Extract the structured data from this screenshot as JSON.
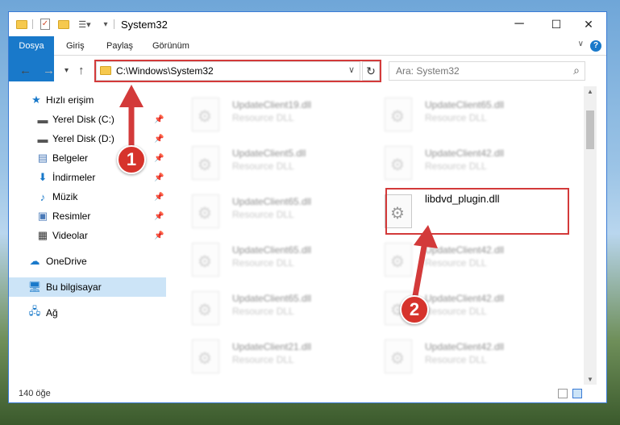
{
  "window": {
    "title": "System32",
    "controls": {
      "minimize": "─",
      "maximize": "☐",
      "close": "✕"
    }
  },
  "ribbon": {
    "tabs": [
      "Dosya",
      "Giriş",
      "Paylaş",
      "Görünüm"
    ],
    "help": "?"
  },
  "nav": {
    "address": "C:\\Windows\\System32",
    "search_placeholder": "Ara: System32"
  },
  "sidebar": {
    "quick_access": "Hızlı erişim",
    "items": [
      {
        "label": "Yerel Disk (C:)",
        "icon": "drive-icon"
      },
      {
        "label": "Yerel Disk (D:)",
        "icon": "drive-icon"
      },
      {
        "label": "Belgeler",
        "icon": "documents-icon"
      },
      {
        "label": "İndirmeler",
        "icon": "downloads-icon"
      },
      {
        "label": "Müzik",
        "icon": "music-icon"
      },
      {
        "label": "Resimler",
        "icon": "pictures-icon"
      },
      {
        "label": "Videolar",
        "icon": "videos-icon"
      }
    ],
    "onedrive": "OneDrive",
    "this_pc": "Bu bilgisayar",
    "network": "Ağ"
  },
  "files": {
    "left": [
      {
        "name": "UpdateClient19.dll",
        "type": "Resource DLL"
      },
      {
        "name": "UpdateClient5.dll",
        "type": "Resource DLL"
      },
      {
        "name": "UpdateClient65.dll",
        "type": "Resource DLL"
      },
      {
        "name": "UpdateClient65.dll",
        "type": "Resource DLL"
      },
      {
        "name": "UpdateClient65.dll",
        "type": "Resource DLL"
      },
      {
        "name": "UpdateClient21.dll",
        "type": "Resource DLL"
      }
    ],
    "right": [
      {
        "name": "UpdateClient65.dll",
        "type": "Resource DLL"
      },
      {
        "name": "UpdateClient42.dll",
        "type": "Resource DLL"
      },
      {
        "name": "libdvd_plugin.dll",
        "type": ""
      },
      {
        "name": "UpdateClient42.dll",
        "type": "Resource DLL"
      },
      {
        "name": "UpdateClient42.dll",
        "type": "Resource DLL"
      },
      {
        "name": "UpdateClient42.dll",
        "type": "Resource DLL"
      }
    ]
  },
  "status": {
    "count": "140 öğe"
  },
  "annotations": {
    "step1": "1",
    "step2": "2",
    "color": "#d33a3a"
  }
}
